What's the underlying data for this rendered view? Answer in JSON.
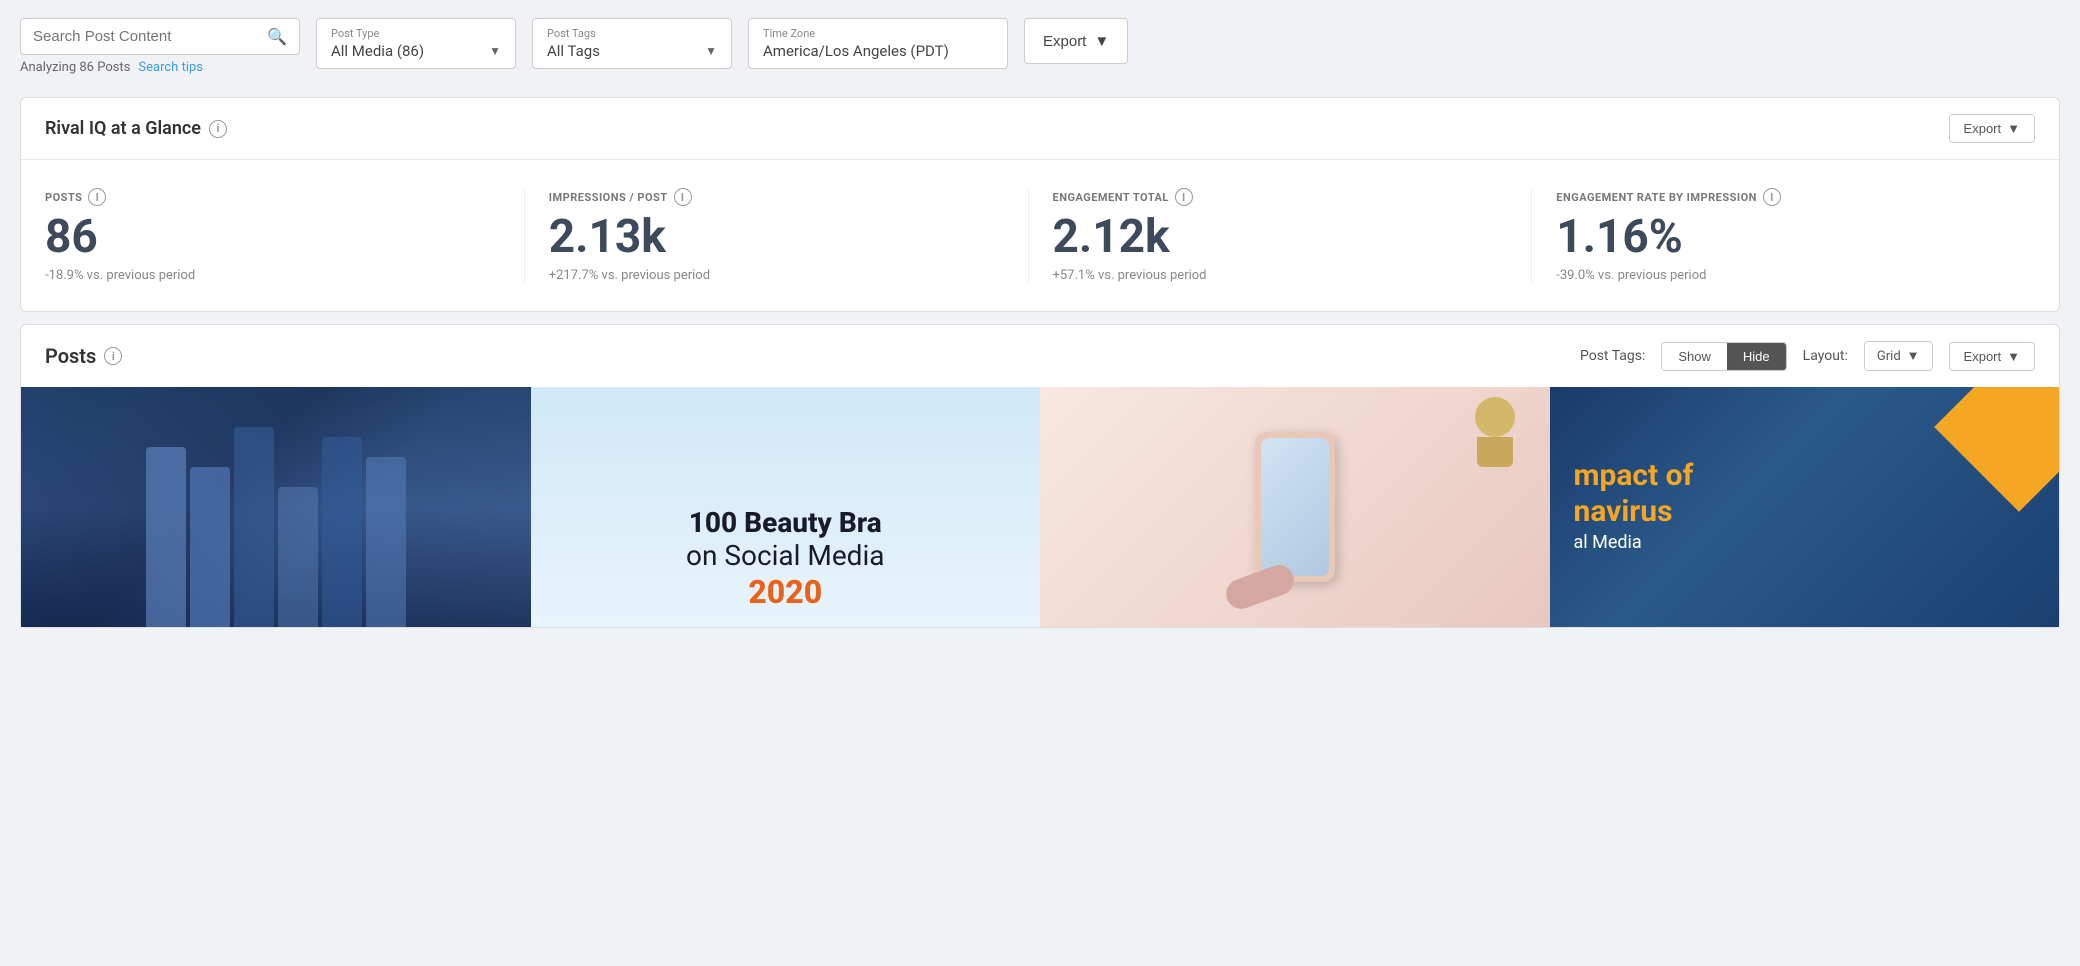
{
  "topBar": {
    "searchPlaceholder": "Search Post Content",
    "analyzingText": "Analyzing 86 Posts",
    "searchTipsText": "Search tips",
    "postType": {
      "label": "Post Type",
      "value": "All Media (86)"
    },
    "postTags": {
      "label": "Post Tags",
      "value": "All Tags"
    },
    "timeZone": {
      "label": "Time Zone",
      "value": "America/Los Angeles (PDT)"
    },
    "exportButton": "Export"
  },
  "glanceSection": {
    "title": "Rival IQ at a Glance",
    "exportButton": "Export",
    "stats": [
      {
        "label": "POSTS",
        "value": "86",
        "change": "-18.9% vs. previous period"
      },
      {
        "label": "IMPRESSIONS / POST",
        "value": "2.13k",
        "change": "+217.7% vs. previous period"
      },
      {
        "label": "ENGAGEMENT TOTAL",
        "value": "2.12k",
        "change": "+57.1% vs. previous period"
      },
      {
        "label": "ENGAGEMENT RATE BY IMPRESSION",
        "value": "1.16%",
        "change": "-39.0% vs. previous period"
      }
    ]
  },
  "postsSection": {
    "title": "Posts",
    "postTagsLabel": "Post Tags:",
    "showButton": "Show",
    "hideButton": "Hide",
    "layoutLabel": "Layout:",
    "layoutValue": "Grid",
    "exportButton": "Export",
    "posts": [
      {
        "id": 1,
        "type": "people-phones",
        "altText": "People using phones"
      },
      {
        "id": 2,
        "type": "beauty-brands",
        "titleMain": "100 Beauty Bra",
        "titleSub": "on Social Media",
        "year": "2020"
      },
      {
        "id": 3,
        "type": "phone-hands",
        "altText": "Hands holding phone"
      },
      {
        "id": 4,
        "type": "impact-text",
        "line1": "mpact of",
        "line2": "navirus",
        "line3": "al Media"
      }
    ]
  }
}
